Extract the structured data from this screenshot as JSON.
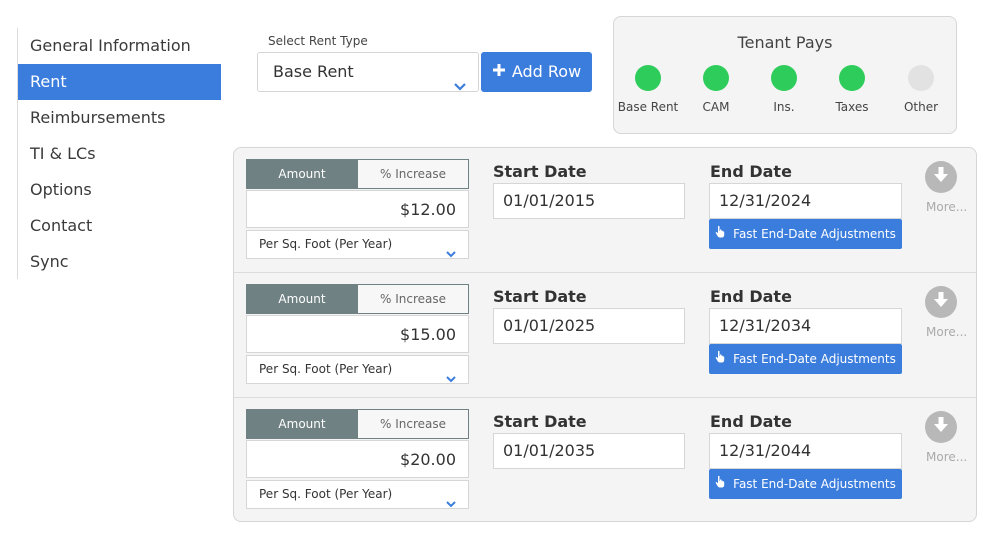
{
  "sidebar": {
    "items": [
      {
        "label": "General Information",
        "active": false
      },
      {
        "label": "Rent",
        "active": true
      },
      {
        "label": "Reimbursements",
        "active": false
      },
      {
        "label": "TI & LCs",
        "active": false
      },
      {
        "label": "Options",
        "active": false
      },
      {
        "label": "Contact",
        "active": false
      },
      {
        "label": "Sync",
        "active": false
      }
    ]
  },
  "rent_type": {
    "label": "Select Rent Type",
    "value": "Base Rent",
    "add_row_label": "Add Row"
  },
  "tenant_pays": {
    "title": "Tenant Pays",
    "items": [
      {
        "label": "Base Rent",
        "state": "on"
      },
      {
        "label": "CAM",
        "state": "on"
      },
      {
        "label": "Ins.",
        "state": "on"
      },
      {
        "label": "Taxes",
        "state": "on"
      },
      {
        "label": "Other",
        "state": "off"
      }
    ]
  },
  "colors": {
    "accent": "#3b7ddd",
    "toggle_active": "#6f8183",
    "status_on": "#2ecc5b",
    "status_off": "#e2e2e2"
  },
  "rows": [
    {
      "amount_tab": "Amount",
      "increase_tab": "% Increase",
      "amount": "$12.00",
      "unit": "Per Sq. Foot (Per Year)",
      "start_label": "Start Date",
      "start_date": "01/01/2015",
      "end_label": "End Date",
      "end_date": "12/31/2024",
      "fast_label": "Fast End-Date Adjustments",
      "more_label": "More..."
    },
    {
      "amount_tab": "Amount",
      "increase_tab": "% Increase",
      "amount": "$15.00",
      "unit": "Per Sq. Foot (Per Year)",
      "start_label": "Start Date",
      "start_date": "01/01/2025",
      "end_label": "End Date",
      "end_date": "12/31/2034",
      "fast_label": "Fast End-Date Adjustments",
      "more_label": "More..."
    },
    {
      "amount_tab": "Amount",
      "increase_tab": "% Increase",
      "amount": "$20.00",
      "unit": "Per Sq. Foot (Per Year)",
      "start_label": "Start Date",
      "start_date": "01/01/2035",
      "end_label": "End Date",
      "end_date": "12/31/2044",
      "fast_label": "Fast End-Date Adjustments",
      "more_label": "More..."
    }
  ]
}
